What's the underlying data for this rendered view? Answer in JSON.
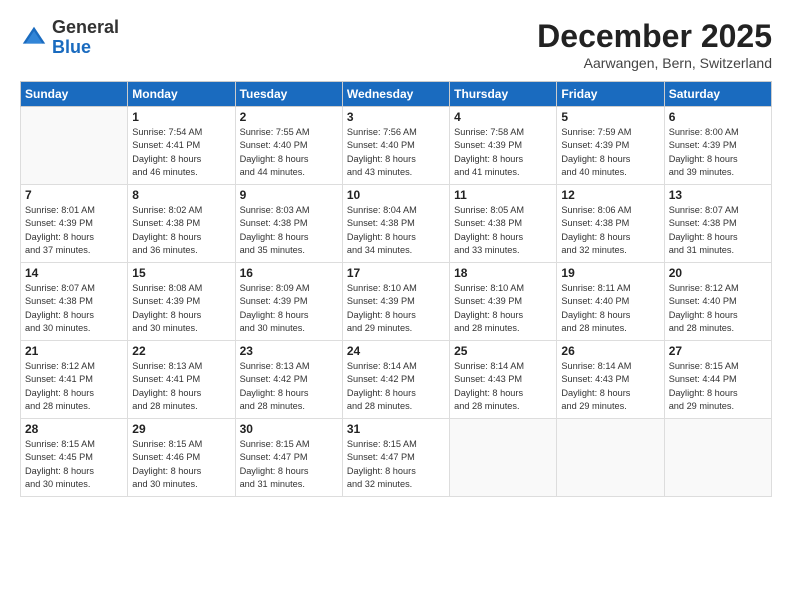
{
  "header": {
    "logo": {
      "general": "General",
      "blue": "Blue"
    },
    "title": "December 2025",
    "location": "Aarwangen, Bern, Switzerland"
  },
  "days_of_week": [
    "Sunday",
    "Monday",
    "Tuesday",
    "Wednesday",
    "Thursday",
    "Friday",
    "Saturday"
  ],
  "weeks": [
    [
      {
        "day": "",
        "info": ""
      },
      {
        "day": "1",
        "info": "Sunrise: 7:54 AM\nSunset: 4:41 PM\nDaylight: 8 hours\nand 46 minutes."
      },
      {
        "day": "2",
        "info": "Sunrise: 7:55 AM\nSunset: 4:40 PM\nDaylight: 8 hours\nand 44 minutes."
      },
      {
        "day": "3",
        "info": "Sunrise: 7:56 AM\nSunset: 4:40 PM\nDaylight: 8 hours\nand 43 minutes."
      },
      {
        "day": "4",
        "info": "Sunrise: 7:58 AM\nSunset: 4:39 PM\nDaylight: 8 hours\nand 41 minutes."
      },
      {
        "day": "5",
        "info": "Sunrise: 7:59 AM\nSunset: 4:39 PM\nDaylight: 8 hours\nand 40 minutes."
      },
      {
        "day": "6",
        "info": "Sunrise: 8:00 AM\nSunset: 4:39 PM\nDaylight: 8 hours\nand 39 minutes."
      }
    ],
    [
      {
        "day": "7",
        "info": "Sunrise: 8:01 AM\nSunset: 4:39 PM\nDaylight: 8 hours\nand 37 minutes."
      },
      {
        "day": "8",
        "info": "Sunrise: 8:02 AM\nSunset: 4:38 PM\nDaylight: 8 hours\nand 36 minutes."
      },
      {
        "day": "9",
        "info": "Sunrise: 8:03 AM\nSunset: 4:38 PM\nDaylight: 8 hours\nand 35 minutes."
      },
      {
        "day": "10",
        "info": "Sunrise: 8:04 AM\nSunset: 4:38 PM\nDaylight: 8 hours\nand 34 minutes."
      },
      {
        "day": "11",
        "info": "Sunrise: 8:05 AM\nSunset: 4:38 PM\nDaylight: 8 hours\nand 33 minutes."
      },
      {
        "day": "12",
        "info": "Sunrise: 8:06 AM\nSunset: 4:38 PM\nDaylight: 8 hours\nand 32 minutes."
      },
      {
        "day": "13",
        "info": "Sunrise: 8:07 AM\nSunset: 4:38 PM\nDaylight: 8 hours\nand 31 minutes."
      }
    ],
    [
      {
        "day": "14",
        "info": "Sunrise: 8:07 AM\nSunset: 4:38 PM\nDaylight: 8 hours\nand 30 minutes."
      },
      {
        "day": "15",
        "info": "Sunrise: 8:08 AM\nSunset: 4:39 PM\nDaylight: 8 hours\nand 30 minutes."
      },
      {
        "day": "16",
        "info": "Sunrise: 8:09 AM\nSunset: 4:39 PM\nDaylight: 8 hours\nand 30 minutes."
      },
      {
        "day": "17",
        "info": "Sunrise: 8:10 AM\nSunset: 4:39 PM\nDaylight: 8 hours\nand 29 minutes."
      },
      {
        "day": "18",
        "info": "Sunrise: 8:10 AM\nSunset: 4:39 PM\nDaylight: 8 hours\nand 28 minutes."
      },
      {
        "day": "19",
        "info": "Sunrise: 8:11 AM\nSunset: 4:40 PM\nDaylight: 8 hours\nand 28 minutes."
      },
      {
        "day": "20",
        "info": "Sunrise: 8:12 AM\nSunset: 4:40 PM\nDaylight: 8 hours\nand 28 minutes."
      }
    ],
    [
      {
        "day": "21",
        "info": "Sunrise: 8:12 AM\nSunset: 4:41 PM\nDaylight: 8 hours\nand 28 minutes."
      },
      {
        "day": "22",
        "info": "Sunrise: 8:13 AM\nSunset: 4:41 PM\nDaylight: 8 hours\nand 28 minutes."
      },
      {
        "day": "23",
        "info": "Sunrise: 8:13 AM\nSunset: 4:42 PM\nDaylight: 8 hours\nand 28 minutes."
      },
      {
        "day": "24",
        "info": "Sunrise: 8:14 AM\nSunset: 4:42 PM\nDaylight: 8 hours\nand 28 minutes."
      },
      {
        "day": "25",
        "info": "Sunrise: 8:14 AM\nSunset: 4:43 PM\nDaylight: 8 hours\nand 28 minutes."
      },
      {
        "day": "26",
        "info": "Sunrise: 8:14 AM\nSunset: 4:43 PM\nDaylight: 8 hours\nand 29 minutes."
      },
      {
        "day": "27",
        "info": "Sunrise: 8:15 AM\nSunset: 4:44 PM\nDaylight: 8 hours\nand 29 minutes."
      }
    ],
    [
      {
        "day": "28",
        "info": "Sunrise: 8:15 AM\nSunset: 4:45 PM\nDaylight: 8 hours\nand 30 minutes."
      },
      {
        "day": "29",
        "info": "Sunrise: 8:15 AM\nSunset: 4:46 PM\nDaylight: 8 hours\nand 30 minutes."
      },
      {
        "day": "30",
        "info": "Sunrise: 8:15 AM\nSunset: 4:47 PM\nDaylight: 8 hours\nand 31 minutes."
      },
      {
        "day": "31",
        "info": "Sunrise: 8:15 AM\nSunset: 4:47 PM\nDaylight: 8 hours\nand 32 minutes."
      },
      {
        "day": "",
        "info": ""
      },
      {
        "day": "",
        "info": ""
      },
      {
        "day": "",
        "info": ""
      }
    ]
  ]
}
